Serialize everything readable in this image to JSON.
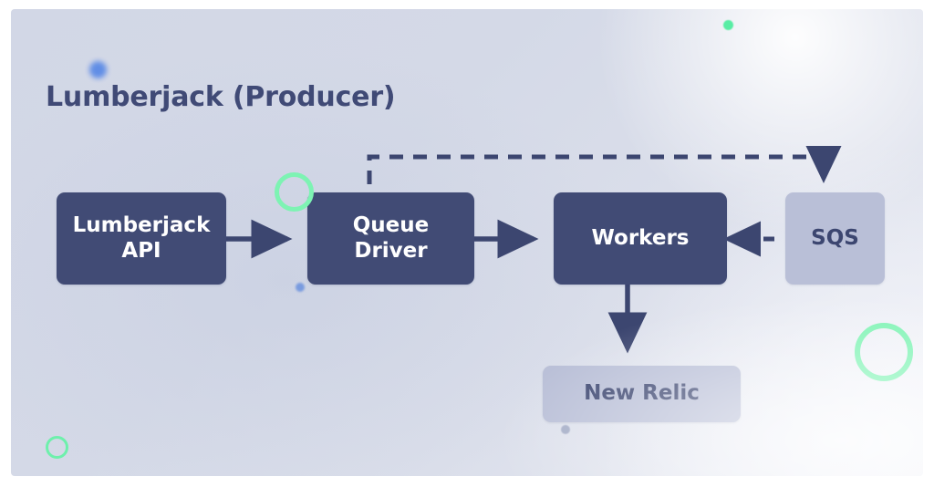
{
  "slide": {
    "title": "Lumberjack (Producer)",
    "background_start": "#d2d7e6",
    "background_end": "#e9ebf3"
  },
  "palette": {
    "node_dark_fill": "#414b75",
    "node_dark_text": "#ffffff",
    "node_light_fill": "#b9bfd7",
    "node_light_text": "#3c4670",
    "title_color": "#404a76",
    "arrow_color": "#3c4670",
    "accent_green": "#7df3b3",
    "accent_blue": "#5b8ae6"
  },
  "nodes": [
    {
      "id": "lumberjack-api",
      "label": "Lumberjack\nAPI",
      "line1": "Lumberjack",
      "line2": "API",
      "style": "dark"
    },
    {
      "id": "queue-driver",
      "label": "Queue\nDriver",
      "line1": "Queue",
      "line2": "Driver",
      "style": "dark"
    },
    {
      "id": "workers",
      "label": "Workers",
      "line1": "Workers",
      "line2": "",
      "style": "dark"
    },
    {
      "id": "sqs",
      "label": "SQS",
      "line1": "SQS",
      "line2": "",
      "style": "light"
    },
    {
      "id": "new-relic",
      "label": "New Relic",
      "line1": "New Relic",
      "line2": "",
      "style": "light"
    }
  ],
  "connections": [
    {
      "id": "api-to-queue",
      "from": "lumberjack-api",
      "to": "queue-driver",
      "style": "solid",
      "direction": "right",
      "label": ""
    },
    {
      "id": "queue-to-workers",
      "from": "queue-driver",
      "to": "workers",
      "style": "solid",
      "direction": "right",
      "label": ""
    },
    {
      "id": "queue-to-sqs",
      "from": "queue-driver",
      "to": "sqs",
      "style": "dashed",
      "direction": "down",
      "label": ""
    },
    {
      "id": "sqs-to-workers",
      "from": "sqs",
      "to": "workers",
      "style": "dashed",
      "direction": "left",
      "label": ""
    },
    {
      "id": "workers-to-newrelic",
      "from": "workers",
      "to": "new-relic",
      "style": "solid",
      "direction": "down",
      "label": ""
    }
  ],
  "decorations": [
    {
      "id": "ring-near-queue-driver",
      "shape": "ring",
      "color": "#7df3b3"
    },
    {
      "id": "ring-right",
      "shape": "ring",
      "color": "#7df3b3"
    },
    {
      "id": "ring-bottom-left",
      "shape": "ring",
      "color": "#6ef0ac"
    },
    {
      "id": "dot-green-top-right",
      "shape": "dot",
      "color": "#58eda4"
    },
    {
      "id": "dot-blue-title",
      "shape": "dot",
      "color": "#5b8ae6"
    },
    {
      "id": "dot-blue-queue-driver",
      "shape": "dot",
      "color": "#7196df"
    },
    {
      "id": "dot-grey-new-relic",
      "shape": "dot",
      "color": "#9aa3c0"
    }
  ]
}
